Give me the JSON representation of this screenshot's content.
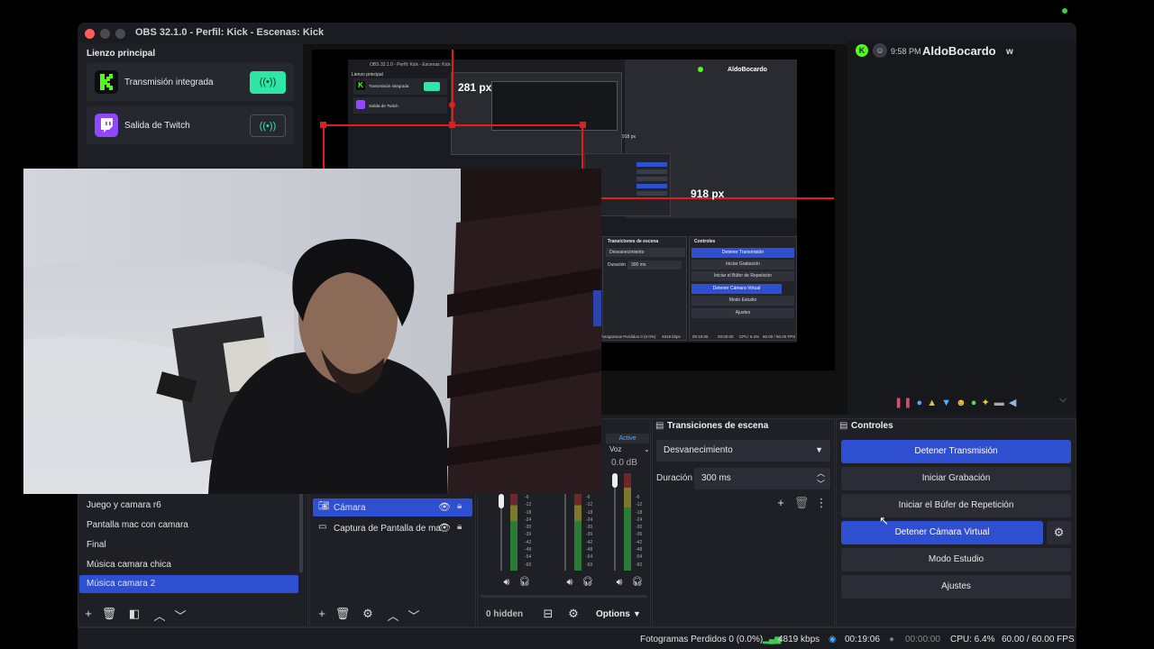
{
  "window": {
    "title": "OBS 32.1.0 - Perfil: Kick - Escenas: Kick"
  },
  "outputs": {
    "header": "Lienzo principal",
    "items": [
      {
        "label": "Transmisión integrada",
        "icon": "kick-logo-icon",
        "active": true
      },
      {
        "label": "Salida de Twitch",
        "icon": "twitch-logo-icon",
        "active": false
      }
    ]
  },
  "preview": {
    "measure_top": "281 px",
    "measure_right": "918 px",
    "nested": {
      "outputs_header": "Lienzo principal",
      "out1": "Transmisión integrada",
      "out2": "Salida de Twitch",
      "title": "OBS 32.1.0 - Perfil: Kick - Escenas: Kick",
      "chat_user": "AldoBocardo",
      "measure": "918 px",
      "trans_header": "Transiciones de escena",
      "ctl_header": "Controles",
      "trans_value": "Desvanecimiento",
      "duration_label": "Duración",
      "duration_value": "300 ms",
      "btn1": "Detener Transmisión",
      "btn2": "Iniciar Grabación",
      "btn3": "Iniciar el Búfer de Repetición",
      "btn4": "Detener Cámara Virtual",
      "btn5": "Modo Estudio",
      "btn6": "Ajustes",
      "status": "Fotogramas Perdidos 0 (0.0%)",
      "kbps": "4819 kbps",
      "time": "00:19:06",
      "rec_time": "00:00:00",
      "cpu": "CPU: 6.4%",
      "fps": "60.00 / 60.00 FPS"
    }
  },
  "chat": {
    "time": "9:58 PM",
    "user": "AldoBocardo",
    "badge": "w"
  },
  "scenes": {
    "items": [
      "Juego y camara r6",
      "Pantalla mac con camara",
      "Final",
      "Música camara chica",
      "Música camara 2"
    ],
    "selected_index": 4
  },
  "sources": {
    "items": [
      {
        "label": "Cámara",
        "selected": true
      },
      {
        "label": "Captura de Pantalla de ma",
        "selected": false
      }
    ]
  },
  "mixer": {
    "active_label": "Active",
    "voice_label": "Voz",
    "db": "0.0 dB",
    "ticks": [
      "-6",
      "-12",
      "-18",
      "-24",
      "-30",
      "-36",
      "-42",
      "-48",
      "-54",
      "-60"
    ],
    "hidden": "0 hidden",
    "options": "Options"
  },
  "transitions": {
    "header": "Transiciones de escena",
    "selected": "Desvanecimiento",
    "duration_label": "Duración",
    "duration_value": "300 ms"
  },
  "controls": {
    "header": "Controles",
    "stop_stream": "Detener Transmisión",
    "start_record": "Iniciar Grabación",
    "start_replay": "Iniciar el Búfer de Repetición",
    "stop_virtualcam": "Detener Cámara Virtual",
    "studio_mode": "Modo Estudio",
    "settings": "Ajustes"
  },
  "status": {
    "dropped": "Fotogramas Perdidos 0 (0.0%)",
    "kbps": "4819 kbps",
    "stream_time": "00:19:06",
    "record_time": "00:00:00",
    "cpu": "CPU: 6.4%",
    "fps": "60.00 / 60.00 FPS"
  },
  "colors": {
    "accent": "#2f4fd1",
    "kick": "#53fc18",
    "twitch": "#9146ff",
    "live_green": "#2ee6a6",
    "red_guide": "#e11d1d"
  }
}
